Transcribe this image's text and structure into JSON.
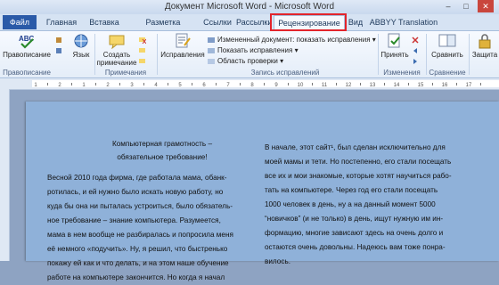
{
  "window": {
    "title": "Документ Microsoft Word - Microsoft Word",
    "min": "–",
    "max": "□",
    "close": "✕"
  },
  "tabs": [
    "Файл",
    "Главная",
    "Вставка",
    "Разметка страницы",
    "Ссылки",
    "Рассылки",
    "Рецензирование",
    "Вид",
    "ABBYY Translation"
  ],
  "ribbon": {
    "spelling": "Правописание",
    "language": "Язык",
    "new_comment_1": "Создать",
    "new_comment_2": "примечание",
    "track_changes": "Исправления",
    "display_for_review": "Измененный документ: показать исправления",
    "show_markup": "Показать исправления",
    "reviewing_pane": "Область проверки",
    "accept": "Принять",
    "compare": "Сравнить",
    "protect": "Защита",
    "groups": {
      "proofing": "Правописание",
      "comments": "Примечания",
      "tracking": "Запись исправлений",
      "changes": "Изменения",
      "compare": "Сравнение"
    }
  },
  "document": {
    "left_title_1": "Компьютерная грамотность –",
    "left_title_2": "обязательное требование!",
    "left_lines": [
      "Весной 2010 года фирма, где работала мама, обанк-",
      "ротилась, и ей нужно было искать новую работу, но",
      "куда бы она ни пыталась устроиться, было обязатель-",
      "ное требование – знание компьютера. Разумеется,",
      "мама в нем вообще не разбиралась и попросила меня",
      "её немного «подучить». Ну, я решил, что быстренько",
      "покажу ей как и что делать, и на этом наше обучение",
      "работе на компьютере закончится. Но когда я начал"
    ],
    "right_lines": [
      "В начале, этот сайт¹, был сделан исключительно для",
      "моей мамы и тети. Но постепенно, его стали посещать",
      "все их и мои знакомые, которые хотят научиться рабо-",
      "тать на компьютере. Через год его стали посещать",
      "1000 человек в день, ну а на данный момент 5000",
      "“новичков” (и не только) в день, ищут нужную им ин-",
      "формацию, многие зависают здесь на очень долго и",
      "остаются очень довольны. Надеюсь вам тоже понра-",
      "вилось."
    ]
  },
  "ruler_numbers": [
    "1",
    "2",
    "1",
    "2",
    "3",
    "4",
    "5",
    "6",
    "7",
    "8",
    "9",
    "10",
    "11",
    "12",
    "13",
    "14",
    "15",
    "16",
    "17"
  ],
  "colors": {
    "highlight": "#e3242b",
    "file_tab": "#2a5aa8",
    "page": "#8fb1d9"
  }
}
